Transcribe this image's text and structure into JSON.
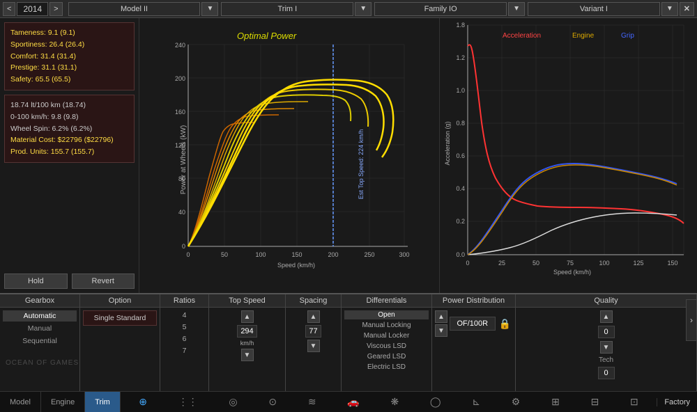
{
  "topbar": {
    "prev_year": "<",
    "next_year": ">",
    "year": "2014",
    "model_label": "Model II",
    "trim_label": "Trim I",
    "family_label": "Family IO",
    "variant_label": "Variant I",
    "close": "✕"
  },
  "left_panel": {
    "stats1": {
      "tameness": "Tameness: 9.1 (9.1)",
      "sportiness": "Sportiness: 26.4 (26.4)",
      "comfort": "Comfort: 31.4 (31.4)",
      "prestige": "Prestige: 31.1 (31.1)",
      "safety": "Safety: 65.5 (65.5)"
    },
    "stats2": {
      "fuel": "18.74 lt/100 km (18.74)",
      "zero_hundred": "0-100 km/h: 9.8 (9.8)",
      "wheel_spin": "Wheel Spin: 6.2% (6.2%)",
      "material_cost": "Material Cost: $22796 ($22796)",
      "prod_units": "Prod. Units: 155.7 (155.7)"
    },
    "hold_btn": "Hold",
    "revert_btn": "Revert"
  },
  "chart": {
    "title": "Optimal Power",
    "y_label": "Power at Wheels (kW)",
    "x_label": "Speed (km/h)",
    "est_speed": "Est Top Speed: 224 km/h"
  },
  "right_chart": {
    "legend": {
      "acceleration": "Acceleration",
      "engine": "Engine",
      "grip": "Grip"
    },
    "y_label": "Acceleration (g)",
    "x_label": "Speed (km/h)"
  },
  "bottom": {
    "gearbox": {
      "header": "Gearbox",
      "options": [
        "Automatic",
        "Manual",
        "Sequential"
      ],
      "active": "Automatic"
    },
    "option": {
      "header": "Option",
      "value": "Single Standard"
    },
    "ratios": {
      "header": "Ratios",
      "values": [
        "4",
        "5",
        "6",
        "7"
      ]
    },
    "top_speed": {
      "header": "Top Speed",
      "value": "294",
      "unit": "km/h"
    },
    "spacing": {
      "header": "Spacing",
      "value": "77"
    },
    "differentials": {
      "header": "Differentials",
      "options": [
        "Open",
        "Manual Locking",
        "Manual Locker",
        "Viscous LSD",
        "Geared LSD",
        "Electric LSD"
      ],
      "active": "Open"
    },
    "power_dist": {
      "header": "Power Distribution",
      "value": "OF/100R"
    },
    "quality": {
      "header": "Quality",
      "value": "0",
      "tech_label": "Tech",
      "tech_value": "0"
    }
  },
  "bottom_nav": {
    "model_tab": "Model",
    "engine_tab": "Engine",
    "trim_tab": "Trim",
    "factory_label": "Factory"
  }
}
